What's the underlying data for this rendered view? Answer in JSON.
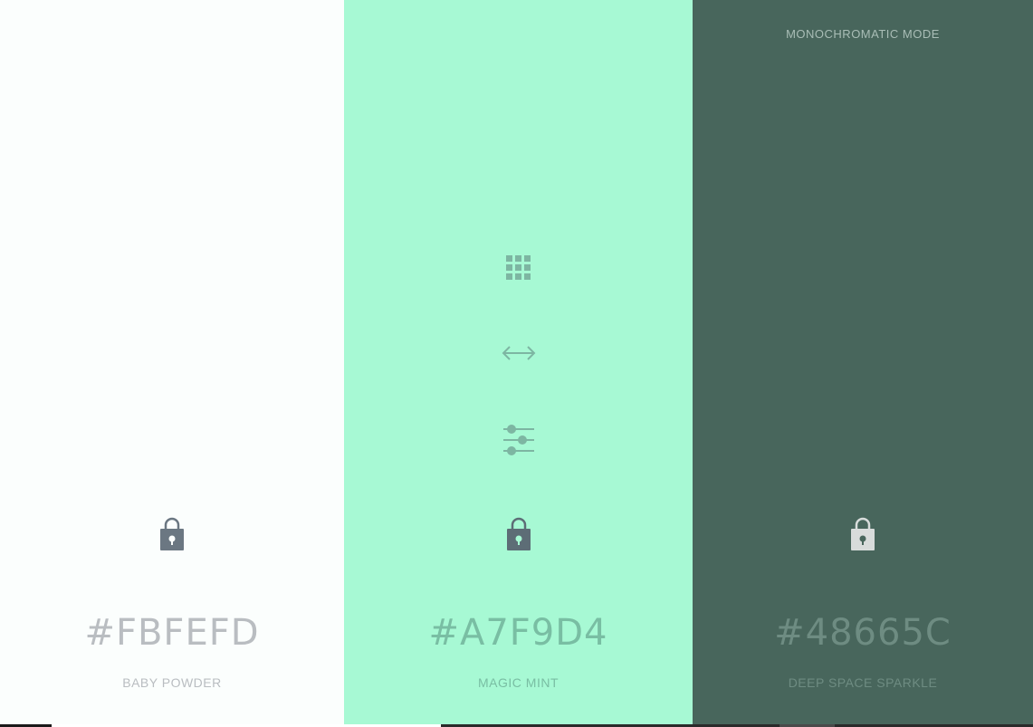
{
  "mode_label": "MONOCHROMATIC MODE",
  "colors": [
    {
      "hex": "#FBFEFD",
      "name": "BABY POWDER",
      "text_color": "#B9BDC1",
      "lock_color": "#6B7782",
      "lock_hole": "#FBFEFD"
    },
    {
      "hex": "#A7F9D4",
      "name": "MAGIC MINT",
      "text_color": "#79BEA3",
      "lock_color": "#5D6D76",
      "lock_hole": "#A7F9D4"
    },
    {
      "hex": "#48665C",
      "name": "DEEP SPACE SPARKLE",
      "text_color": "#6E8C82",
      "lock_color": "#D8DCDB",
      "lock_hole": "#48665C"
    }
  ],
  "tool_color": "#7DB6A2",
  "mode_label_color": "#A9BDB6",
  "icons": {
    "grid": "grid-icon",
    "arrows": "horizontal-arrows-icon",
    "sliders": "sliders-icon",
    "lock": "lock-icon"
  },
  "bottom_strip_colors": [
    "#1A1A1A",
    "#FFFFFF",
    "#2A2A2A",
    "#4A4A4A",
    "#2A2A2A"
  ]
}
